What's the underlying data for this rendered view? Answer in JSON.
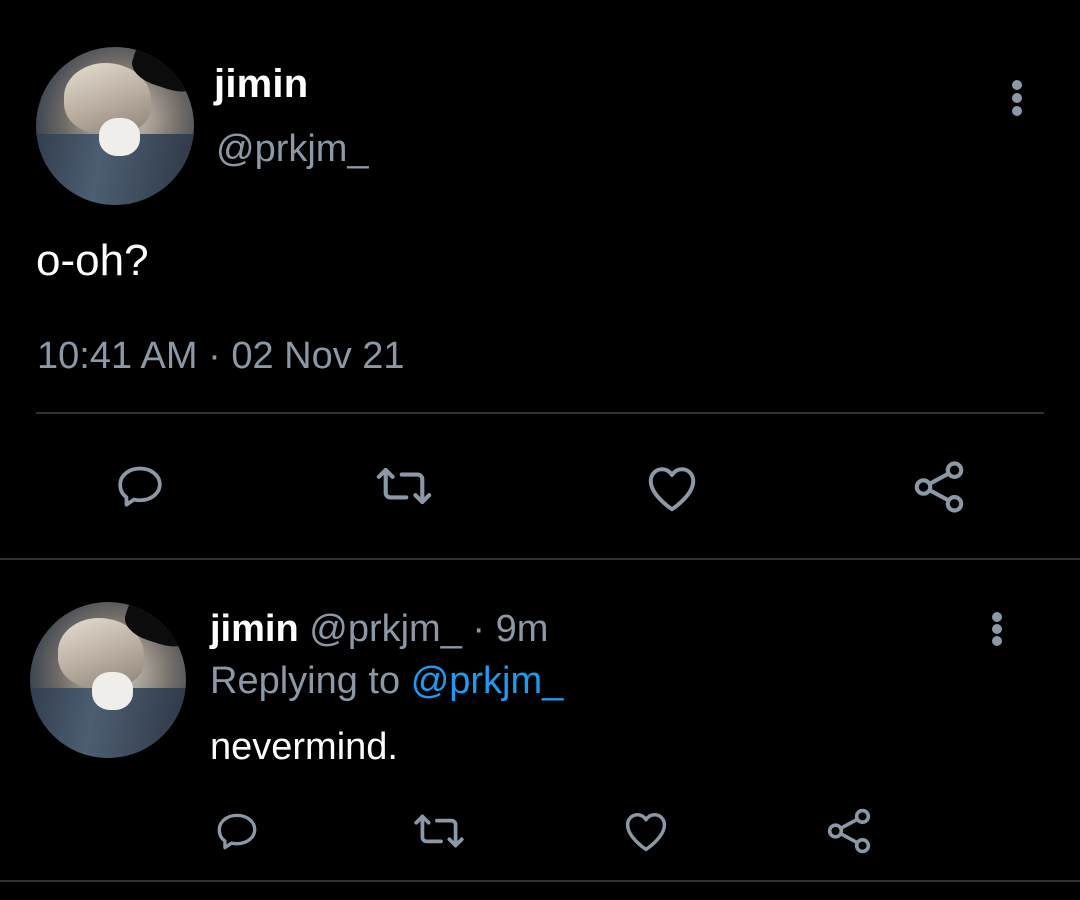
{
  "main_tweet": {
    "author_name": "jimin",
    "author_handle": "@prkjm_",
    "text": "o-oh?",
    "timestamp": "10:41 AM · 02 Nov 21",
    "avatar_icon": "profile-photo",
    "more_icon": "more-vertical-icon"
  },
  "actions": [
    "reply-icon",
    "retweet-icon",
    "like-icon",
    "share-icon"
  ],
  "reply_tweet": {
    "author_name": "jimin",
    "author_meta": "@prkjm_ · 9m",
    "replying_prefix": "Replying to",
    "replying_to": "@prkjm_",
    "text": "nevermind.",
    "avatar_icon": "profile-photo",
    "more_icon": "more-vertical-icon"
  },
  "colors": {
    "background": "#000000",
    "primary_text": "#ffffff",
    "secondary_text": "#8b98a5",
    "accent": "#1d9bf0",
    "divider": "#2f3336"
  }
}
